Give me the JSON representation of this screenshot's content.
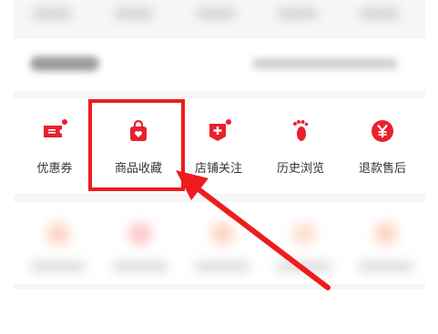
{
  "accent_color": "#e8212d",
  "annotation_color": "#ee1c1c",
  "header": {
    "left_text": "",
    "right_text": ""
  },
  "tools": [
    {
      "label": "优惠券",
      "icon": "ticket-icon",
      "badge": true
    },
    {
      "label": "商品收藏",
      "icon": "shopping-bag-heart-icon",
      "badge": false
    },
    {
      "label": "店铺关注",
      "icon": "shop-plus-icon",
      "badge": true
    },
    {
      "label": "历史浏览",
      "icon": "footprint-icon",
      "badge": false
    },
    {
      "label": "退款售后",
      "icon": "yen-circle-icon",
      "badge": false
    }
  ],
  "annotation": {
    "target": "商品收藏",
    "type": "red-box-and-arrow"
  }
}
